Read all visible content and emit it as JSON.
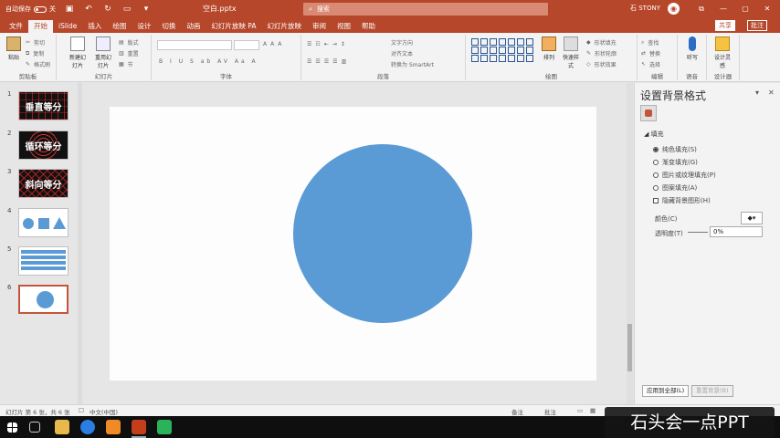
{
  "titlebar": {
    "autosave_label": "自动保存",
    "autosave_state": "关",
    "filename": "空白.pptx",
    "search_placeholder": "搜索",
    "user": "石 STONY",
    "window_buttons": [
      "⧉",
      "—",
      "▢",
      "✕"
    ]
  },
  "tabs": [
    "文件",
    "开始",
    "iSlide",
    "插入",
    "绘图",
    "设计",
    "切换",
    "动画",
    "幻灯片放映 PA",
    "幻灯片放映",
    "审阅",
    "视图",
    "帮助"
  ],
  "active_tab": "开始",
  "share_label": "共享",
  "comment_label": "批注",
  "ribbon": {
    "clipboard": {
      "paste": "粘贴",
      "cut": "剪切",
      "copy": "复制",
      "format": "格式刷",
      "label": "剪贴板"
    },
    "slides": {
      "new": "新建幻灯片",
      "reuse": "重用幻灯片",
      "layout": "版式",
      "reset": "重置",
      "section": "节",
      "label": "幻灯片"
    },
    "font": {
      "label": "字体",
      "styles": "B I U S ab AV Aa A"
    },
    "paragraph": {
      "label": "段落",
      "text_direction": "文字方向",
      "align_text": "对齐文本",
      "smartart": "转换为 SmartArt"
    },
    "drawing": {
      "arrange": "排列",
      "quick_styles": "快速样式",
      "shape_fill": "形状填充",
      "shape_outline": "形状轮廓",
      "shape_effects": "形状效果",
      "label": "绘图"
    },
    "editing": {
      "find": "查找",
      "replace": "替换",
      "select": "选择",
      "label": "编辑"
    },
    "voice": {
      "dictate": "听写",
      "label": "语音"
    },
    "designer": {
      "ideas": "设计灵感",
      "label": "设计器"
    }
  },
  "slides": [
    {
      "num": "1",
      "text": "垂直等分",
      "style": "grid"
    },
    {
      "num": "2",
      "text": "循环等分",
      "style": "rings"
    },
    {
      "num": "3",
      "text": "斜向等分",
      "style": "diag"
    },
    {
      "num": "4",
      "text": "",
      "style": "shapes"
    },
    {
      "num": "5",
      "text": "",
      "style": "stripes"
    },
    {
      "num": "6",
      "text": "",
      "style": "circle"
    }
  ],
  "pane": {
    "title": "设置背景格式",
    "section": "填充",
    "options": [
      {
        "label": "纯色填充(S)",
        "type": "radio",
        "selected": true
      },
      {
        "label": "渐变填充(G)",
        "type": "radio",
        "selected": false
      },
      {
        "label": "图片或纹理填充(P)",
        "type": "radio",
        "selected": false
      },
      {
        "label": "图案填充(A)",
        "type": "radio",
        "selected": false
      },
      {
        "label": "隐藏背景图形(H)",
        "type": "checkbox",
        "selected": false
      }
    ],
    "color_label": "颜色(C)",
    "transparency_label": "透明度(T)",
    "transparency_value": "0%",
    "apply_all": "应用到全部(L)",
    "reset_bg": "重置背景(B)"
  },
  "status": {
    "slide_info": "幻灯片 第 6 张，共 6 张",
    "language": "中文(中国)",
    "notes": "备注",
    "comments": "批注"
  },
  "watermark": "石头会一点PPT",
  "colors": {
    "accent": "#b7472a",
    "circle": "#5b9bd5"
  }
}
